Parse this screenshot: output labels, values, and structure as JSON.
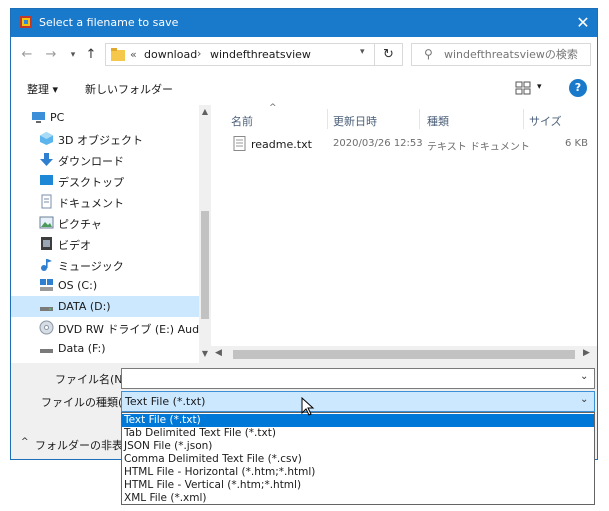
{
  "window": {
    "title": "Select a filename to save"
  },
  "address": {
    "prefix": "«",
    "segments": [
      "download",
      "windefthreatsview"
    ]
  },
  "search": {
    "placeholder": "windefthreatsviewの検索"
  },
  "toolbar": {
    "organize": "整理 ▾",
    "new_folder": "新しいフォルダー"
  },
  "nav": {
    "items": [
      {
        "label": "PC",
        "icon": "pc-icon"
      },
      {
        "label": "3D オブジェクト",
        "icon": "3d-objects-icon"
      },
      {
        "label": "ダウンロード",
        "icon": "download-icon"
      },
      {
        "label": "デスクトップ",
        "icon": "desktop-icon"
      },
      {
        "label": "ドキュメント",
        "icon": "document-icon"
      },
      {
        "label": "ピクチャ",
        "icon": "pictures-icon"
      },
      {
        "label": "ビデオ",
        "icon": "video-icon"
      },
      {
        "label": "ミュージック",
        "icon": "music-icon"
      },
      {
        "label": "OS (C:)",
        "icon": "drive-c-icon"
      },
      {
        "label": "DATA (D:)",
        "icon": "drive-d-icon",
        "selected": true
      },
      {
        "label": "DVD RW ドライブ (E:) Audio CD",
        "icon": "dvd-icon"
      },
      {
        "label": "Data (F:)",
        "icon": "drive-f-icon"
      }
    ]
  },
  "files": {
    "columns": [
      "名前",
      "更新日時",
      "種類",
      "サイズ"
    ],
    "rows": [
      {
        "name": "readme.txt",
        "modified": "2020/03/26 12:53",
        "type": "テキスト ドキュメント",
        "size": "6 KB"
      }
    ]
  },
  "form": {
    "filename_label": "ファイル名(N):",
    "filename_value": "",
    "filetype_label": "ファイルの種類(T):",
    "filetype_value": "Text File (*.txt)",
    "filetype_options": [
      "Text File (*.txt)",
      "Tab Delimited Text File (*.txt)",
      "JSON File (*.json)",
      "Comma Delimited Text File (*.csv)",
      "HTML File - Horizontal (*.htm;*.html)",
      "HTML File - Vertical (*.htm;*.html)",
      "XML File (*.xml)"
    ],
    "selected_option": 0
  },
  "footer": {
    "hide_folders": "フォルダーの非表示"
  },
  "colors": {
    "accent": "#1979ca",
    "selection": "#cce8ff",
    "highlight": "#0078d7"
  }
}
